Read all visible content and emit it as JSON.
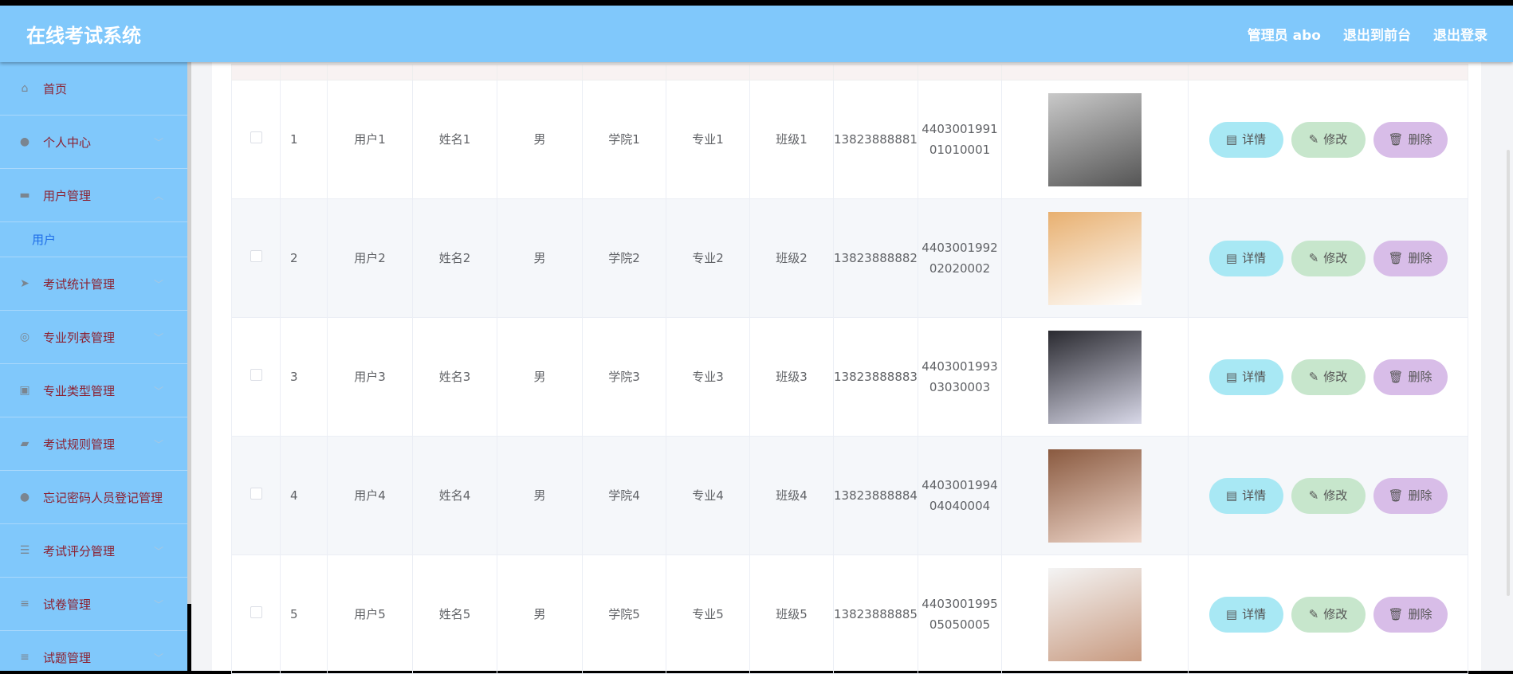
{
  "header": {
    "title": "在线考试系统",
    "user": "管理员 abo",
    "to_front": "退出到前台",
    "logout": "退出登录"
  },
  "sidebar": {
    "items": [
      {
        "label": "首页",
        "icon": "home-icon",
        "glyph": "⌂"
      },
      {
        "label": "个人中心",
        "icon": "user-icon",
        "glyph": "●",
        "chev": "﹀"
      },
      {
        "label": "用户管理",
        "icon": "users-icon",
        "glyph": "▬",
        "chev": "︿"
      },
      {
        "label": "考试统计管理",
        "icon": "send-icon",
        "glyph": "➤",
        "chev": "﹀"
      },
      {
        "label": "专业列表管理",
        "icon": "target-icon",
        "glyph": "◎",
        "chev": "﹀"
      },
      {
        "label": "专业类型管理",
        "icon": "clipboard-icon",
        "glyph": "▣",
        "chev": "﹀"
      },
      {
        "label": "考试规则管理",
        "icon": "briefcase-icon",
        "glyph": "▰",
        "chev": "﹀"
      },
      {
        "label": "忘记密码人员登记管理",
        "icon": "user-icon",
        "glyph": "●"
      },
      {
        "label": "考试评分管理",
        "icon": "sliders-icon",
        "glyph": "☰",
        "chev": "﹀"
      },
      {
        "label": "试卷管理",
        "icon": "menu-icon",
        "glyph": "≡",
        "chev": "﹀"
      },
      {
        "label": "试题管理",
        "icon": "menu-icon",
        "glyph": "≡",
        "chev": "﹀"
      }
    ],
    "sub": "用户"
  },
  "actions": {
    "detail": "详情",
    "edit": "修改",
    "delete": "删除"
  },
  "rows": [
    {
      "no": "1",
      "user": "用户1",
      "name": "姓名1",
      "sex": "男",
      "college": "学院1",
      "major": "专业1",
      "class": "班级1",
      "phone": "13823888881",
      "id": "440300199101010001",
      "c1": "#c9c9c9",
      "c2": "#555"
    },
    {
      "no": "2",
      "user": "用户2",
      "name": "姓名2",
      "sex": "男",
      "college": "学院2",
      "major": "专业2",
      "class": "班级2",
      "phone": "13823888882",
      "id": "440300199202020002",
      "c1": "#e8b070",
      "c2": "#fff"
    },
    {
      "no": "3",
      "user": "用户3",
      "name": "姓名3",
      "sex": "男",
      "college": "学院3",
      "major": "专业3",
      "class": "班级3",
      "phone": "13823888883",
      "id": "440300199303030003",
      "c1": "#2a2a30",
      "c2": "#d8d8e8"
    },
    {
      "no": "4",
      "user": "用户4",
      "name": "姓名4",
      "sex": "男",
      "college": "学院4",
      "major": "专业4",
      "class": "班级4",
      "phone": "13823888884",
      "id": "440300199404040004",
      "c1": "#8a5a40",
      "c2": "#f0d8cc"
    },
    {
      "no": "5",
      "user": "用户5",
      "name": "姓名5",
      "sex": "男",
      "college": "学院5",
      "major": "专业5",
      "class": "班级5",
      "phone": "13823888885",
      "id": "440300199505050005",
      "c1": "#f4f4f4",
      "c2": "#c89a80"
    }
  ]
}
